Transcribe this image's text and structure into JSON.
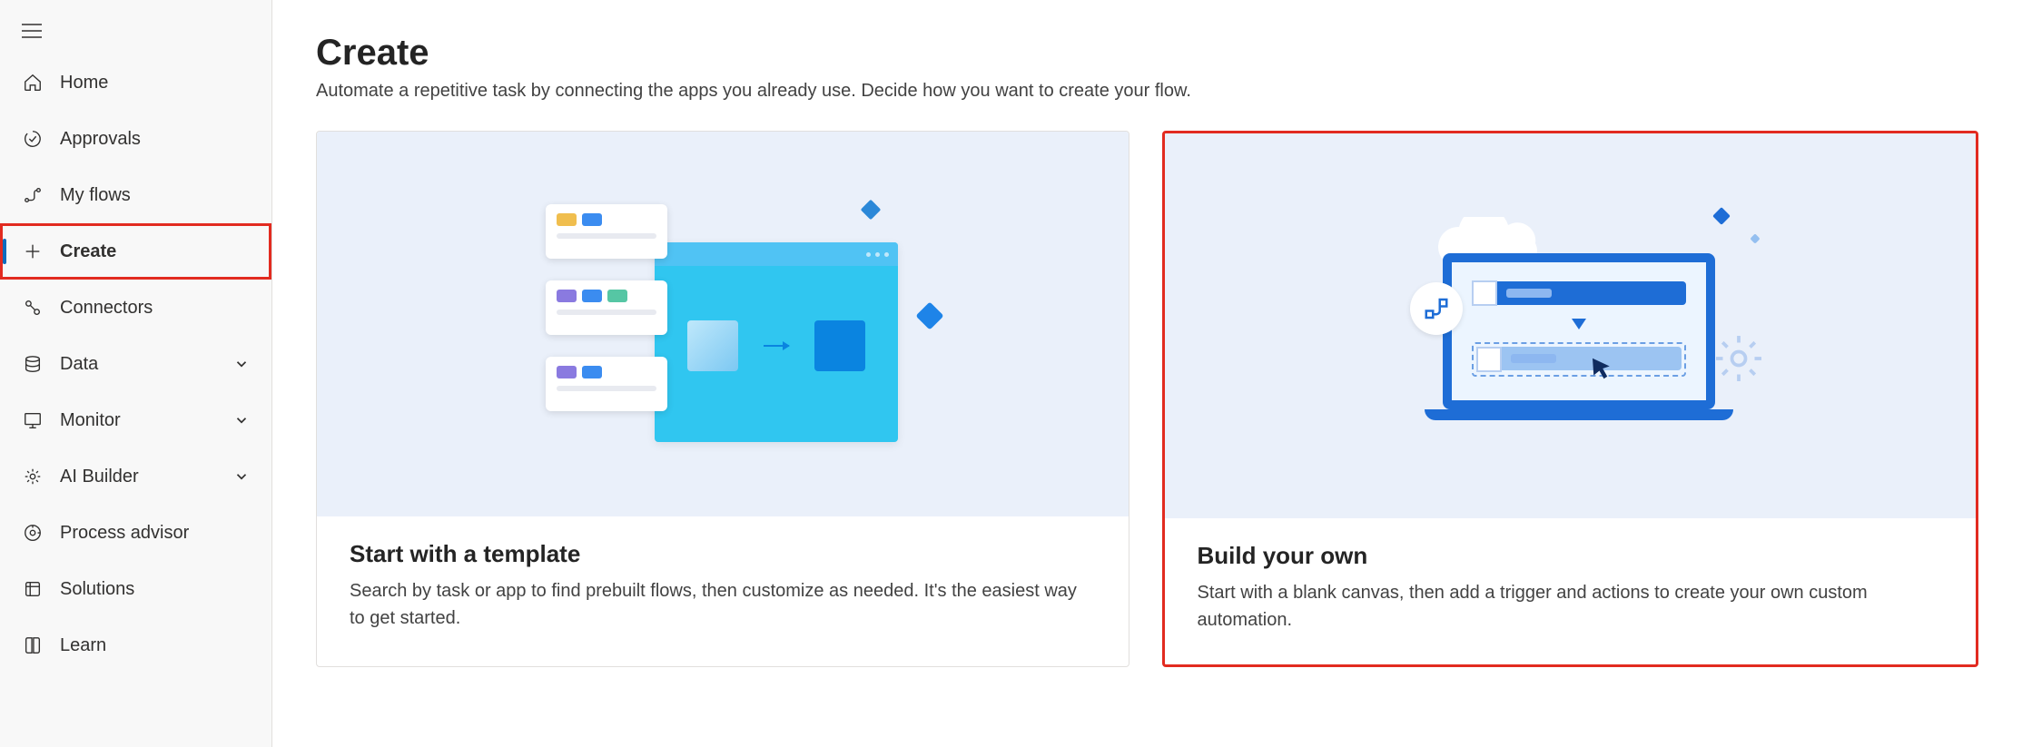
{
  "nav": {
    "items": [
      {
        "icon": "home",
        "label": "Home"
      },
      {
        "icon": "approvals",
        "label": "Approvals"
      },
      {
        "icon": "flows",
        "label": "My flows"
      },
      {
        "icon": "plus",
        "label": "Create",
        "active": true,
        "highlight": true
      },
      {
        "icon": "connectors",
        "label": "Connectors"
      },
      {
        "icon": "data",
        "label": "Data",
        "expandable": true
      },
      {
        "icon": "monitor",
        "label": "Monitor",
        "expandable": true
      },
      {
        "icon": "ai",
        "label": "AI Builder",
        "expandable": true
      },
      {
        "icon": "process",
        "label": "Process advisor"
      },
      {
        "icon": "solutions",
        "label": "Solutions"
      },
      {
        "icon": "learn",
        "label": "Learn"
      }
    ]
  },
  "page": {
    "title": "Create",
    "subtitle": "Automate a repetitive task by connecting the apps you already use. Decide how you want to create your flow."
  },
  "cards": [
    {
      "title": "Start with a template",
      "desc": "Search by task or app to find prebuilt flows, then customize as needed. It's the easiest way to get started.",
      "highlight": false
    },
    {
      "title": "Build your own",
      "desc": "Start with a blank canvas, then add a trigger and actions to create your own custom automation.",
      "highlight": true
    }
  ]
}
